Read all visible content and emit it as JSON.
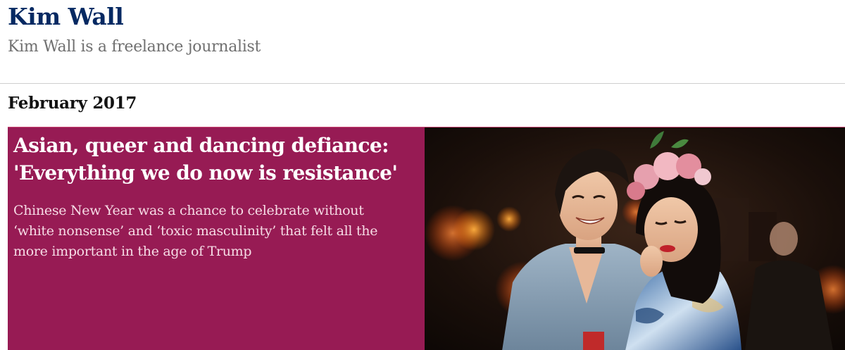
{
  "profile": {
    "name": "Kim Wall",
    "bio": "Kim Wall is a freelance journalist"
  },
  "section": {
    "date": "February 2017"
  },
  "article": {
    "headline": "Asian, queer and dancing defiance: 'Everything we do now is resistance'",
    "standfirst": "Chinese New Year was a chance to celebrate without ‘white nonsense’ and ‘toxic masculinity’ that felt all the more important in the age of Trump"
  },
  "colors": {
    "name": "#052962",
    "card_background": "#971b54",
    "headline": "#ffffff",
    "standfirst": "#f6dbe5"
  }
}
